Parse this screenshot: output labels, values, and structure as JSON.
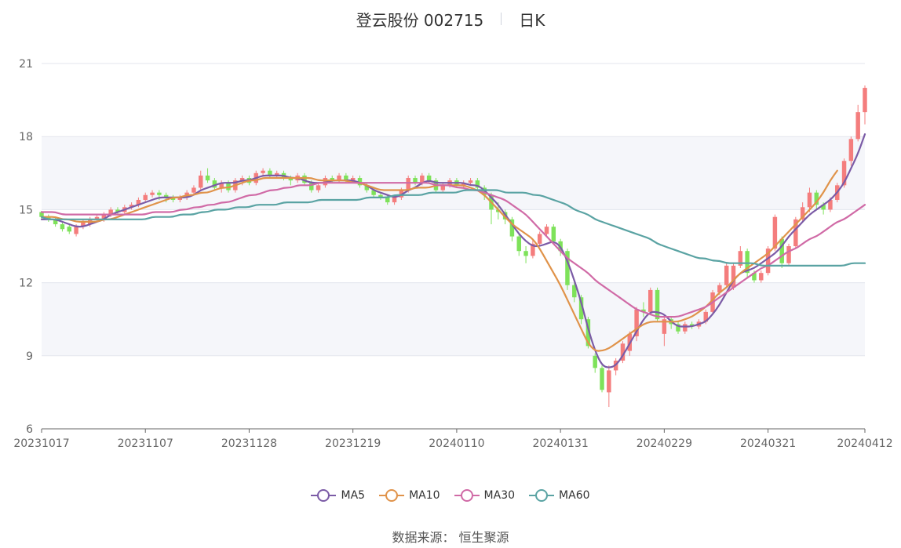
{
  "header": {
    "stock": "登云股份 002715",
    "period": "日K"
  },
  "source_text": "数据来源：  恒生聚源",
  "chart_data": {
    "type": "candlestick",
    "ylim": [
      6,
      21
    ],
    "yticks": [
      6,
      9,
      12,
      15,
      18,
      21
    ],
    "shaded_bands": [
      [
        9,
        12
      ],
      [
        15,
        18
      ]
    ],
    "xticks": [
      "20231017",
      "20231107",
      "20231128",
      "20231219",
      "20240110",
      "20240131",
      "20240229",
      "20240321",
      "20240412"
    ],
    "dates": [
      "20231017",
      "20231018",
      "20231019",
      "20231020",
      "20231023",
      "20231024",
      "20231025",
      "20231026",
      "20231027",
      "20231030",
      "20231031",
      "20231101",
      "20231102",
      "20231103",
      "20231106",
      "20231107",
      "20231108",
      "20231109",
      "20231110",
      "20231113",
      "20231114",
      "20231115",
      "20231116",
      "20231117",
      "20231120",
      "20231121",
      "20231122",
      "20231123",
      "20231124",
      "20231127",
      "20231128",
      "20231129",
      "20231130",
      "20231201",
      "20231204",
      "20231205",
      "20231206",
      "20231207",
      "20231208",
      "20231211",
      "20231212",
      "20231213",
      "20231214",
      "20231215",
      "20231218",
      "20231219",
      "20231220",
      "20231221",
      "20231222",
      "20231225",
      "20231226",
      "20231227",
      "20231228",
      "20231229",
      "20240102",
      "20240103",
      "20240104",
      "20240105",
      "20240108",
      "20240109",
      "20240110",
      "20240111",
      "20240112",
      "20240115",
      "20240116",
      "20240117",
      "20240118",
      "20240119",
      "20240122",
      "20240123",
      "20240124",
      "20240125",
      "20240126",
      "20240129",
      "20240130",
      "20240131",
      "20240201",
      "20240202",
      "20240205",
      "20240206",
      "20240207",
      "20240208",
      "20240219",
      "20240220",
      "20240221",
      "20240222",
      "20240223",
      "20240226",
      "20240227",
      "20240228",
      "20240229",
      "20240301",
      "20240304",
      "20240305",
      "20240306",
      "20240307",
      "20240308",
      "20240311",
      "20240312",
      "20240313",
      "20240314",
      "20240315",
      "20240318",
      "20240319",
      "20240320",
      "20240321",
      "20240322",
      "20240325",
      "20240326",
      "20240327",
      "20240328",
      "20240329",
      "20240401",
      "20240402",
      "20240403",
      "20240408",
      "20240409",
      "20240410",
      "20240411",
      "20240412"
    ],
    "ohlc": [
      [
        14.9,
        14.7,
        14.95,
        14.6
      ],
      [
        14.7,
        14.6,
        14.8,
        14.5
      ],
      [
        14.6,
        14.4,
        14.7,
        14.3
      ],
      [
        14.4,
        14.2,
        14.5,
        14.1
      ],
      [
        14.3,
        14.1,
        14.4,
        14.0
      ],
      [
        14.0,
        14.3,
        14.4,
        13.9
      ],
      [
        14.3,
        14.5,
        14.6,
        14.2
      ],
      [
        14.4,
        14.6,
        14.7,
        14.3
      ],
      [
        14.6,
        14.7,
        14.8,
        14.5
      ],
      [
        14.6,
        14.8,
        14.9,
        14.5
      ],
      [
        14.8,
        15.0,
        15.1,
        14.7
      ],
      [
        15.0,
        14.9,
        15.1,
        14.8
      ],
      [
        14.9,
        15.1,
        15.2,
        14.8
      ],
      [
        15.1,
        15.2,
        15.3,
        15.0
      ],
      [
        15.2,
        15.4,
        15.5,
        15.1
      ],
      [
        15.4,
        15.6,
        15.7,
        15.3
      ],
      [
        15.6,
        15.7,
        15.8,
        15.5
      ],
      [
        15.7,
        15.6,
        15.8,
        15.4
      ],
      [
        15.6,
        15.5,
        15.7,
        15.3
      ],
      [
        15.5,
        15.4,
        15.6,
        15.3
      ],
      [
        15.4,
        15.5,
        15.6,
        15.3
      ],
      [
        15.5,
        15.7,
        15.8,
        15.4
      ],
      [
        15.7,
        15.9,
        16.0,
        15.6
      ],
      [
        15.9,
        16.4,
        16.6,
        15.8
      ],
      [
        16.4,
        16.2,
        16.7,
        16.1
      ],
      [
        16.2,
        15.9,
        16.3,
        15.8
      ],
      [
        15.9,
        16.1,
        16.2,
        15.7
      ],
      [
        16.1,
        15.8,
        16.2,
        15.7
      ],
      [
        15.8,
        16.2,
        16.3,
        15.7
      ],
      [
        16.2,
        16.3,
        16.4,
        16.0
      ],
      [
        16.3,
        16.1,
        16.4,
        16.0
      ],
      [
        16.1,
        16.5,
        16.6,
        16.0
      ],
      [
        16.5,
        16.6,
        16.7,
        16.4
      ],
      [
        16.6,
        16.4,
        16.7,
        16.3
      ],
      [
        16.4,
        16.5,
        16.6,
        16.3
      ],
      [
        16.5,
        16.3,
        16.6,
        16.2
      ],
      [
        16.3,
        16.2,
        16.4,
        16.0
      ],
      [
        16.2,
        16.4,
        16.5,
        16.1
      ],
      [
        16.4,
        16.1,
        16.5,
        16.0
      ],
      [
        16.1,
        15.8,
        16.2,
        15.7
      ],
      [
        15.8,
        16.0,
        16.1,
        15.7
      ],
      [
        16.0,
        16.3,
        16.4,
        15.9
      ],
      [
        16.3,
        16.2,
        16.4,
        16.1
      ],
      [
        16.2,
        16.4,
        16.5,
        16.1
      ],
      [
        16.4,
        16.2,
        16.5,
        16.1
      ],
      [
        16.2,
        16.3,
        16.4,
        16.1
      ],
      [
        16.3,
        16.0,
        16.4,
        15.9
      ],
      [
        16.0,
        15.8,
        16.1,
        15.7
      ],
      [
        15.8,
        15.6,
        15.9,
        15.5
      ],
      [
        15.6,
        15.5,
        15.7,
        15.4
      ],
      [
        15.5,
        15.3,
        15.6,
        15.2
      ],
      [
        15.3,
        15.5,
        15.6,
        15.2
      ],
      [
        15.5,
        15.8,
        15.9,
        15.4
      ],
      [
        15.8,
        16.3,
        16.4,
        15.7
      ],
      [
        16.3,
        16.1,
        16.4,
        16.0
      ],
      [
        16.1,
        16.4,
        16.5,
        16.0
      ],
      [
        16.4,
        16.2,
        16.5,
        16.1
      ],
      [
        16.2,
        15.8,
        16.3,
        15.7
      ],
      [
        15.8,
        16.0,
        16.1,
        15.7
      ],
      [
        16.0,
        16.2,
        16.3,
        15.9
      ],
      [
        16.2,
        16.0,
        16.3,
        15.9
      ],
      [
        16.0,
        16.1,
        16.2,
        15.9
      ],
      [
        16.1,
        16.2,
        16.3,
        16.0
      ],
      [
        16.2,
        15.9,
        16.3,
        15.8
      ],
      [
        15.9,
        15.6,
        16.0,
        15.4
      ],
      [
        15.6,
        15.0,
        15.7,
        14.4
      ],
      [
        15.0,
        14.9,
        15.3,
        14.6
      ],
      [
        14.9,
        14.6,
        15.0,
        14.4
      ],
      [
        14.6,
        13.9,
        14.7,
        13.7
      ],
      [
        13.9,
        13.3,
        14.0,
        13.1
      ],
      [
        13.3,
        13.1,
        13.5,
        12.8
      ],
      [
        13.1,
        13.6,
        13.8,
        13.0
      ],
      [
        13.6,
        14.0,
        14.1,
        13.5
      ],
      [
        14.0,
        14.3,
        14.4,
        13.9
      ],
      [
        14.3,
        13.7,
        14.4,
        13.6
      ],
      [
        13.7,
        13.3,
        13.8,
        13.1
      ],
      [
        13.3,
        11.9,
        13.4,
        11.7
      ],
      [
        11.9,
        11.4,
        12.1,
        11.2
      ],
      [
        11.4,
        10.5,
        11.5,
        10.3
      ],
      [
        10.5,
        9.4,
        10.6,
        9.3
      ],
      [
        9.0,
        8.5,
        9.1,
        8.3
      ],
      [
        8.5,
        7.6,
        8.6,
        7.5
      ],
      [
        7.5,
        8.4,
        8.6,
        6.9
      ],
      [
        8.4,
        8.8,
        8.9,
        8.2
      ],
      [
        8.8,
        9.5,
        9.6,
        8.7
      ],
      [
        9.2,
        9.9,
        10.0,
        9.0
      ],
      [
        9.8,
        10.9,
        11.0,
        9.6
      ],
      [
        10.9,
        10.8,
        11.2,
        10.6
      ],
      [
        10.8,
        11.7,
        11.8,
        10.7
      ],
      [
        11.7,
        10.5,
        11.8,
        10.4
      ],
      [
        9.9,
        10.5,
        10.6,
        9.4
      ],
      [
        10.5,
        10.3,
        10.6,
        10.1
      ],
      [
        10.3,
        10.0,
        10.4,
        9.9
      ],
      [
        10.0,
        10.3,
        10.4,
        9.9
      ],
      [
        10.3,
        10.2,
        10.4,
        10.1
      ],
      [
        10.2,
        10.4,
        10.5,
        10.1
      ],
      [
        10.4,
        10.8,
        10.9,
        10.3
      ],
      [
        10.8,
        11.6,
        11.7,
        10.7
      ],
      [
        11.6,
        11.9,
        12.0,
        11.5
      ],
      [
        11.9,
        12.7,
        12.8,
        11.8
      ],
      [
        11.8,
        12.7,
        12.8,
        11.7
      ],
      [
        12.7,
        13.3,
        13.5,
        12.6
      ],
      [
        13.3,
        12.4,
        13.4,
        12.2
      ],
      [
        12.4,
        12.1,
        12.5,
        12.0
      ],
      [
        12.1,
        12.4,
        12.5,
        12.0
      ],
      [
        12.4,
        13.4,
        13.5,
        12.3
      ],
      [
        13.4,
        14.7,
        14.8,
        13.3
      ],
      [
        13.8,
        12.8,
        13.9,
        12.6
      ],
      [
        12.8,
        13.5,
        13.6,
        12.7
      ],
      [
        13.5,
        14.6,
        14.7,
        13.4
      ],
      [
        14.6,
        15.1,
        15.3,
        14.5
      ],
      [
        15.1,
        15.7,
        15.9,
        14.9
      ],
      [
        15.7,
        15.2,
        15.8,
        15.0
      ],
      [
        15.2,
        15.0,
        15.3,
        14.8
      ],
      [
        15.0,
        15.4,
        15.5,
        14.9
      ],
      [
        15.4,
        16.0,
        16.1,
        15.3
      ],
      [
        16.0,
        17.0,
        17.1,
        15.9
      ],
      [
        17.0,
        17.9,
        18.0,
        16.8
      ],
      [
        17.9,
        19.0,
        19.3,
        17.8
      ],
      [
        19.0,
        20.0,
        20.1,
        18.5
      ]
    ],
    "ma_series": [
      {
        "name": "MA5",
        "color": "#7b5ba6",
        "values": [
          14.6,
          14.6,
          14.6,
          14.5,
          14.4,
          14.3,
          14.3,
          14.4,
          14.5,
          14.6,
          14.8,
          14.9,
          15.0,
          15.1,
          15.2,
          15.3,
          15.4,
          15.5,
          15.5,
          15.5,
          15.5,
          15.5,
          15.6,
          15.8,
          15.9,
          16.0,
          16.1,
          16.1,
          16.1,
          16.2,
          16.2,
          16.3,
          16.4,
          16.4,
          16.4,
          16.4,
          16.3,
          16.3,
          16.2,
          16.1,
          16.1,
          16.1,
          16.2,
          16.2,
          16.2,
          16.2,
          16.1,
          16.0,
          15.8,
          15.7,
          15.6,
          15.5,
          15.6,
          15.8,
          15.9,
          16.1,
          16.2,
          16.1,
          16.1,
          16.1,
          16.1,
          16.1,
          16.0,
          16.0,
          15.8,
          15.5,
          15.2,
          14.8,
          14.4,
          14.0,
          13.7,
          13.5,
          13.5,
          13.6,
          13.7,
          13.5,
          12.9,
          12.1,
          11.2,
          10.1,
          9.2,
          8.6,
          8.5,
          8.6,
          9.0,
          9.5,
          10.0,
          10.5,
          10.8,
          10.8,
          10.7,
          10.4,
          10.2,
          10.2,
          10.2,
          10.3,
          10.4,
          10.7,
          11.1,
          11.6,
          12.1,
          12.4,
          12.5,
          12.6,
          12.8,
          13.0,
          13.2,
          13.5,
          13.9,
          14.2,
          14.5,
          14.8,
          15.0,
          15.2,
          15.4,
          15.7,
          16.1,
          16.7,
          17.3,
          18.1
        ]
      },
      {
        "name": "MA10",
        "color": "#e0934a",
        "values": [
          14.7,
          14.7,
          14.7,
          14.6,
          14.6,
          14.5,
          14.5,
          14.5,
          14.5,
          14.6,
          14.6,
          14.7,
          14.8,
          14.9,
          15.0,
          15.1,
          15.2,
          15.3,
          15.4,
          15.5,
          15.5,
          15.6,
          15.6,
          15.7,
          15.7,
          15.8,
          15.9,
          15.9,
          16.0,
          16.1,
          16.2,
          16.2,
          16.3,
          16.3,
          16.3,
          16.3,
          16.3,
          16.3,
          16.3,
          16.3,
          16.2,
          16.2,
          16.2,
          16.2,
          16.2,
          16.1,
          16.1,
          16.0,
          15.9,
          15.8,
          15.8,
          15.8,
          15.8,
          15.8,
          15.9,
          15.9,
          15.9,
          16.0,
          16.0,
          16.0,
          16.0,
          16.0,
          15.9,
          15.8,
          15.6,
          15.3,
          15.0,
          14.7,
          14.4,
          14.2,
          14.0,
          13.8,
          13.4,
          12.9,
          12.4,
          11.9,
          11.3,
          10.7,
          10.1,
          9.5,
          9.2,
          9.2,
          9.3,
          9.5,
          9.7,
          9.9,
          10.1,
          10.3,
          10.4,
          10.4,
          10.4,
          10.4,
          10.4,
          10.5,
          10.6,
          10.8,
          11.0,
          11.3,
          11.6,
          11.8,
          12.1,
          12.4,
          12.6,
          12.8,
          13.0,
          13.2,
          13.5,
          13.8,
          14.1,
          14.4,
          14.7,
          15.0,
          15.3,
          15.7,
          16.2,
          16.6
        ]
      },
      {
        "name": "MA30",
        "color": "#d06aa6",
        "values": [
          14.9,
          14.9,
          14.9,
          14.8,
          14.8,
          14.8,
          14.8,
          14.8,
          14.8,
          14.8,
          14.8,
          14.8,
          14.8,
          14.8,
          14.8,
          14.8,
          14.9,
          14.9,
          14.9,
          14.9,
          15.0,
          15.0,
          15.1,
          15.1,
          15.2,
          15.2,
          15.3,
          15.3,
          15.4,
          15.5,
          15.6,
          15.6,
          15.7,
          15.8,
          15.8,
          15.9,
          15.9,
          16.0,
          16.0,
          16.0,
          16.1,
          16.1,
          16.1,
          16.1,
          16.1,
          16.1,
          16.1,
          16.1,
          16.1,
          16.1,
          16.1,
          16.1,
          16.1,
          16.1,
          16.1,
          16.1,
          16.1,
          16.0,
          16.0,
          16.0,
          15.9,
          15.9,
          15.8,
          15.8,
          15.7,
          15.6,
          15.5,
          15.4,
          15.2,
          15.0,
          14.8,
          14.5,
          14.2,
          13.9,
          13.6,
          13.3,
          13.0,
          12.8,
          12.6,
          12.4,
          12.1,
          11.9,
          11.7,
          11.5,
          11.3,
          11.1,
          10.9,
          10.8,
          10.7,
          10.6,
          10.6,
          10.6,
          10.6,
          10.7,
          10.8,
          10.9,
          11.0,
          11.2,
          11.4,
          11.6,
          11.8,
          12.0,
          12.2,
          12.4,
          12.6,
          12.7,
          12.9,
          13.1,
          13.3,
          13.4,
          13.6,
          13.8,
          13.9,
          14.1,
          14.3,
          14.5,
          14.6,
          14.8,
          15.0,
          15.2
        ]
      },
      {
        "name": "MA60",
        "color": "#5aa3a3",
        "values": [
          14.7,
          14.6,
          14.6,
          14.6,
          14.6,
          14.6,
          14.6,
          14.6,
          14.6,
          14.6,
          14.6,
          14.6,
          14.6,
          14.6,
          14.6,
          14.6,
          14.7,
          14.7,
          14.7,
          14.7,
          14.8,
          14.8,
          14.8,
          14.9,
          14.9,
          15.0,
          15.0,
          15.0,
          15.1,
          15.1,
          15.1,
          15.2,
          15.2,
          15.2,
          15.2,
          15.3,
          15.3,
          15.3,
          15.3,
          15.3,
          15.4,
          15.4,
          15.4,
          15.4,
          15.4,
          15.4,
          15.4,
          15.5,
          15.5,
          15.5,
          15.5,
          15.6,
          15.6,
          15.6,
          15.6,
          15.6,
          15.7,
          15.7,
          15.7,
          15.7,
          15.7,
          15.8,
          15.8,
          15.8,
          15.8,
          15.8,
          15.8,
          15.7,
          15.7,
          15.7,
          15.7,
          15.6,
          15.6,
          15.5,
          15.4,
          15.3,
          15.2,
          15.0,
          14.9,
          14.8,
          14.6,
          14.5,
          14.4,
          14.3,
          14.2,
          14.1,
          14.0,
          13.9,
          13.8,
          13.6,
          13.5,
          13.4,
          13.3,
          13.2,
          13.1,
          13.0,
          13.0,
          12.9,
          12.9,
          12.8,
          12.8,
          12.8,
          12.8,
          12.8,
          12.7,
          12.7,
          12.7,
          12.7,
          12.7,
          12.7,
          12.7,
          12.7,
          12.7,
          12.7,
          12.7,
          12.7,
          12.7,
          12.8,
          12.8,
          12.8
        ]
      }
    ],
    "up_color": "#f47d7d",
    "down_color": "#7ee25a"
  }
}
